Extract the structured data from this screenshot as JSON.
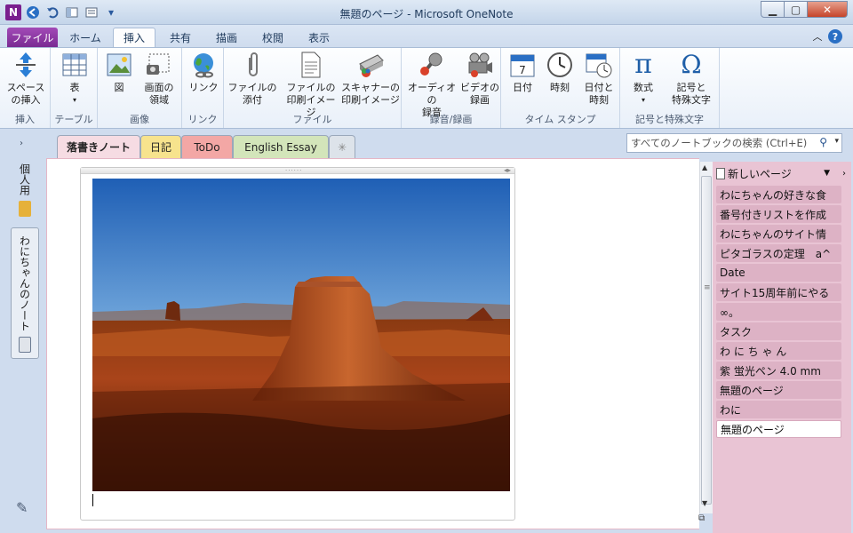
{
  "window": {
    "title": "無題のページ - Microsoft OneNote",
    "app_logo": "N"
  },
  "ribbon_tabs": [
    {
      "label": "ファイル"
    },
    {
      "label": "ホーム"
    },
    {
      "label": "挿入"
    },
    {
      "label": "共有"
    },
    {
      "label": "描画"
    },
    {
      "label": "校閲"
    },
    {
      "label": "表示"
    }
  ],
  "ribbon_groups": {
    "insert_space": {
      "label": "挿入",
      "buttons": [
        {
          "label": "スペース\nの挿入"
        }
      ]
    },
    "table": {
      "label": "テーブル",
      "buttons": [
        {
          "label": "表"
        }
      ]
    },
    "images": {
      "label": "画像",
      "buttons": [
        {
          "label": "図"
        },
        {
          "label": "画面の\n領域"
        }
      ]
    },
    "links": {
      "label": "リンク",
      "buttons": [
        {
          "label": "リンク"
        }
      ]
    },
    "files": {
      "label": "ファイル",
      "buttons": [
        {
          "label": "ファイルの\n添付"
        },
        {
          "label": "ファイルの\n印刷イメージ"
        },
        {
          "label": "スキャナーの\n印刷イメージ"
        }
      ]
    },
    "recording": {
      "label": "録音/録画",
      "buttons": [
        {
          "label": "オーディオの\n録音"
        },
        {
          "label": "ビデオの\n録画"
        }
      ]
    },
    "timestamp": {
      "label": "タイム スタンプ",
      "buttons": [
        {
          "label": "日付"
        },
        {
          "label": "時刻"
        },
        {
          "label": "日付と\n時刻"
        }
      ]
    },
    "symbols": {
      "label": "記号と特殊文字",
      "buttons": [
        {
          "label": "数式"
        },
        {
          "label": "記号と\n特殊文字"
        }
      ]
    }
  },
  "section_tabs": [
    {
      "label": "落書きノート",
      "color": "#f6dce3"
    },
    {
      "label": "日記",
      "color": "#f7e38d"
    },
    {
      "label": "ToDo",
      "color": "#f3a7a5"
    },
    {
      "label": "English Essay",
      "color": "#d3e5ba"
    },
    {
      "label": "✳",
      "color": "#dde3ea"
    }
  ],
  "search": {
    "placeholder": "すべてのノートブックの検索 (Ctrl+E)"
  },
  "notebooks": [
    {
      "label": "個人用"
    },
    {
      "label": "わにちゃんのノート"
    }
  ],
  "page_pane": {
    "new_page_label": "新しいページ",
    "pages": [
      "わにちゃんの好きな食",
      "番号付きリストを作成",
      "わにちゃんのサイト情",
      "ピタゴラスの定理　a^",
      "Date",
      "サイト15周年前にやる",
      "∞。",
      "タスク",
      "わ に ち ゃ ん",
      "紫 蛍光ペン 4.0 mm",
      "無題のページ",
      "わに",
      "無題のページ"
    ],
    "selected_index": 12
  },
  "colors": {
    "accent_file_tab": "#7a2b92",
    "page_pane_bg": "#e9c4d4",
    "selected_page_bg": "#ffffff"
  }
}
